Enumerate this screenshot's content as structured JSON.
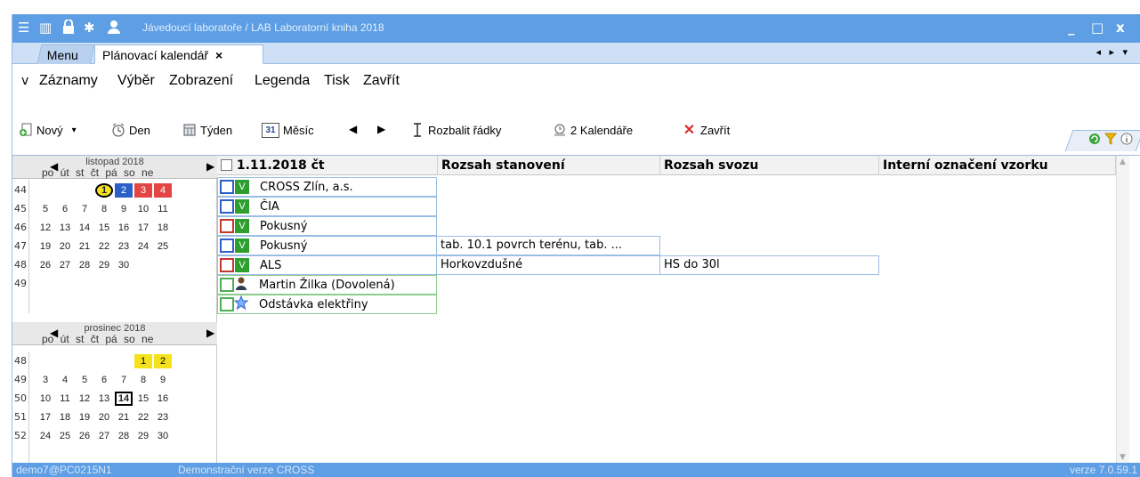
{
  "titlebar": {
    "title": "Jávedoucí laboratoře / LAB  Laboratorní kniha  2018",
    "icons": [
      "menu-icon",
      "book-icon",
      "lock-icon",
      "gear-icon",
      "user-icon"
    ],
    "minimize": "_",
    "maximize": "□",
    "close": "x"
  },
  "tabs": {
    "menu": "Menu",
    "active": "Plánovací kalendář",
    "active_close": "×",
    "nav": "◂ ▸ ▾"
  },
  "menubar": {
    "caret": "v",
    "items": [
      "Záznamy",
      "Výběr",
      "Zobrazení",
      "Legenda",
      "Tisk",
      "Zavřít"
    ]
  },
  "toolbar": {
    "new": "Nový",
    "new_arrow": "▾",
    "day": "Den",
    "week": "Týden",
    "month_icon": "31",
    "month": "Měsíc",
    "prev": "◀",
    "next": "▶",
    "expand": "Rozbalit řádky",
    "calendars": "2 Kalendáře",
    "close": "Zavřít"
  },
  "calendar_nov": {
    "month": "listopad 2018",
    "dows": "po út st čt pá so ne",
    "weeks": [
      "44",
      "45",
      "46",
      "47",
      "48",
      "49"
    ],
    "rows": [
      [
        "",
        "",
        "",
        "1",
        "2",
        "3",
        "4"
      ],
      [
        "5",
        "6",
        "7",
        "8",
        "9",
        "10",
        "11"
      ],
      [
        "12",
        "13",
        "14",
        "15",
        "16",
        "17",
        "18"
      ],
      [
        "19",
        "20",
        "21",
        "22",
        "23",
        "24",
        "25"
      ],
      [
        "26",
        "27",
        "28",
        "29",
        "30",
        "",
        ""
      ],
      [
        "",
        "",
        "",
        "",
        "",
        "",
        ""
      ]
    ]
  },
  "calendar_dec": {
    "month": "prosinec 2018",
    "dows": "po út st čt pá so ne",
    "weeks": [
      "48",
      "49",
      "50",
      "51",
      "52"
    ],
    "rows": [
      [
        "",
        "",
        "",
        "",
        "",
        "1",
        "2"
      ],
      [
        "3",
        "4",
        "5",
        "6",
        "7",
        "8",
        "9"
      ],
      [
        "10",
        "11",
        "12",
        "13",
        "14",
        "15",
        "16"
      ],
      [
        "17",
        "18",
        "19",
        "20",
        "21",
        "22",
        "23"
      ],
      [
        "24",
        "25",
        "26",
        "27",
        "28",
        "29",
        "30"
      ]
    ]
  },
  "grid": {
    "headers": [
      "1.11.2018 čt",
      "Rozsah stanovení",
      "Rozsah svozu",
      "Interní označení vzorku"
    ],
    "rows": [
      {
        "name": "CROSS Zlín, a.s.",
        "rozsah_stanoveni": "",
        "rozsah_svozu": "",
        "color": "#2b60c9",
        "icon": "V"
      },
      {
        "name": "ČIA",
        "rozsah_stanoveni": "",
        "rozsah_svozu": "",
        "color": "#2b60c9",
        "icon": "V"
      },
      {
        "name": "Pokusný",
        "rozsah_stanoveni": "",
        "rozsah_svozu": "",
        "color": "#c0392b",
        "icon": "V"
      },
      {
        "name": "Pokusný",
        "rozsah_stanoveni": "tab. 10.1 povrch terénu, tab. ...",
        "rozsah_svozu": "",
        "color": "#2b60c9",
        "icon": "V"
      },
      {
        "name": "ALS",
        "rozsah_stanoveni": "Horkovzdušné",
        "rozsah_svozu": "HS do 30l",
        "color": "#c0392b",
        "icon": "V"
      },
      {
        "name": "Martin Žilka (Dovolená)",
        "rozsah_stanoveni": "",
        "rozsah_svozu": "",
        "color": "#4caf50",
        "icon": "person-icon"
      },
      {
        "name": "Odstávka elektřiny",
        "rozsah_stanoveni": "",
        "rozsah_svozu": "",
        "color": "#4caf50",
        "icon": "star-icon"
      }
    ]
  },
  "status": {
    "user": "demo7@PC0215N1",
    "edition": "Demonstrační verze CROSS",
    "version": "verze 7.0.59.1"
  }
}
